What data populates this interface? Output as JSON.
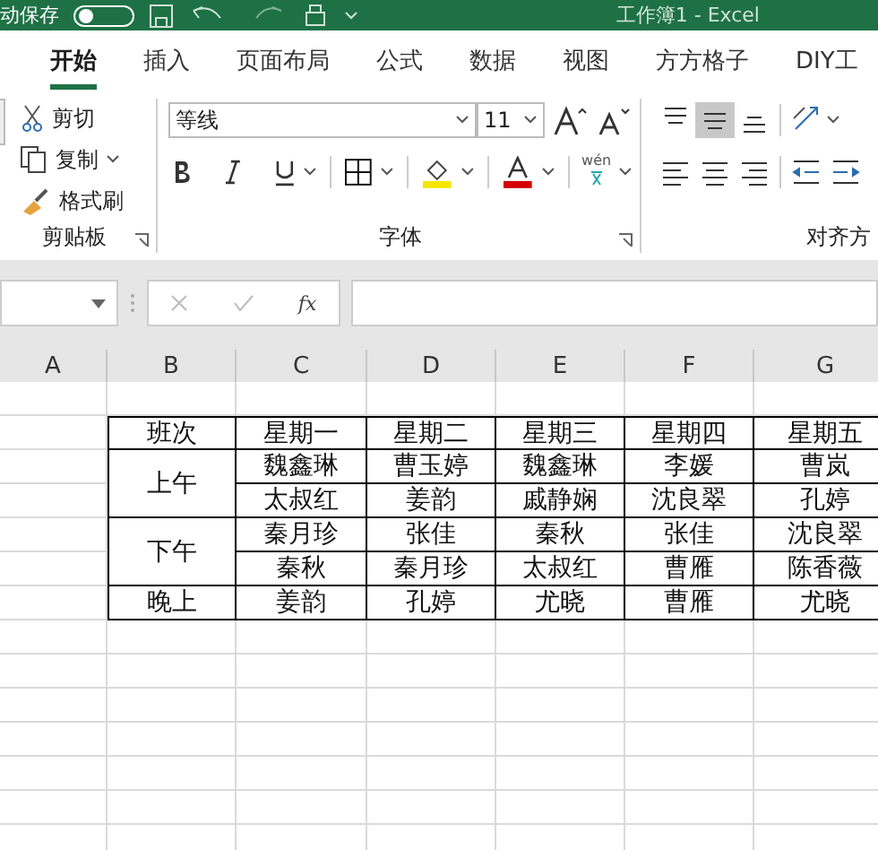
{
  "title_bar": {
    "autosave_label": "动保存",
    "autosave_on": false,
    "title": "工作簿1 - Excel"
  },
  "tabs": [
    {
      "label": "开始",
      "selected": true
    },
    {
      "label": "插入",
      "selected": false
    },
    {
      "label": "页面布局",
      "selected": false
    },
    {
      "label": "公式",
      "selected": false
    },
    {
      "label": "数据",
      "selected": false
    },
    {
      "label": "视图",
      "selected": false
    },
    {
      "label": "方方格子",
      "selected": false
    },
    {
      "label": "DIY工",
      "selected": false
    }
  ],
  "ribbon": {
    "clipboard": {
      "cut": "剪切",
      "copy": "复制",
      "format_painter": "格式刷",
      "label": "剪贴板"
    },
    "font": {
      "name": "等线",
      "size": "11",
      "phonetic": "wén",
      "label": "字体"
    },
    "alignment": {
      "label": "对齐方",
      "buttons": [
        {
          "kind": "top",
          "selected": false
        },
        {
          "kind": "middle",
          "selected": true
        },
        {
          "kind": "bottom",
          "selected": false
        },
        {
          "kind": "orient",
          "selected": false
        },
        {
          "kind": "left",
          "selected": false
        },
        {
          "kind": "center",
          "selected": false
        },
        {
          "kind": "right",
          "selected": false
        },
        {
          "kind": "outdent",
          "selected": false
        },
        {
          "kind": "indent",
          "selected": false
        }
      ]
    }
  },
  "formula_bar": {
    "fx": "fx"
  },
  "sheet": {
    "columns": [
      "A",
      "B",
      "C",
      "D",
      "E",
      "F",
      "G"
    ],
    "header": [
      "班次",
      "星期一",
      "星期二",
      "星期三",
      "星期四",
      "星期五"
    ],
    "shifts": [
      {
        "label": "上午",
        "rows": [
          [
            "魏鑫琳",
            "曹玉婷",
            "魏鑫琳",
            "李媛",
            "曹岚"
          ],
          [
            "太叔红",
            "姜韵",
            "戚静娴",
            "沈良翠",
            "孔婷"
          ]
        ]
      },
      {
        "label": "下午",
        "rows": [
          [
            "秦月珍",
            "张佳",
            "秦秋",
            "张佳",
            "沈良翠"
          ],
          [
            "秦秋",
            "秦月珍",
            "太叔红",
            "曹雁",
            "陈香薇"
          ]
        ]
      },
      {
        "label": "晚上",
        "rows": [
          [
            "姜韵",
            "孔婷",
            "尤晓",
            "曹雁",
            "尤晓"
          ]
        ]
      }
    ]
  }
}
